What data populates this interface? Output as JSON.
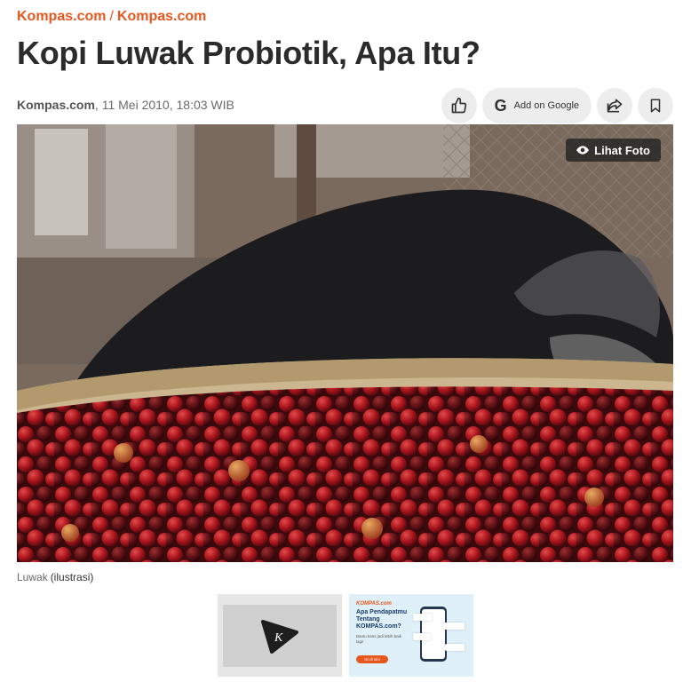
{
  "breadcrumb": {
    "items": [
      "Kompas.com",
      "Kompas.com"
    ],
    "separator": "/"
  },
  "article": {
    "title": "Kopi Luwak Probiotik, Apa Itu?",
    "source": "Kompas.com",
    "date": ", 11 Mei 2010, 18:03 WIB"
  },
  "actions": {
    "google_label": "Add on Google",
    "google_letter": "G"
  },
  "photo": {
    "view_label": "Lihat Foto",
    "caption": "Luwak",
    "credit": "(ilustrasi)"
  },
  "ads": {
    "ad2": {
      "brand": "KOMPAS.com",
      "headline": "Apa Pendapatmu Tentang KOMPAS.com?",
      "subtext": "Bantu kami jadi lebih baik lagi!",
      "cta": "Isi di sini"
    }
  },
  "colors": {
    "accent": "#e8571e",
    "title": "#2b2b2b",
    "button_bg": "#ededed"
  },
  "icons": [
    "thumbs-up-icon",
    "google-g-icon",
    "share-icon",
    "bookmark-icon",
    "eye-icon",
    "kompas-play-logo-icon"
  ]
}
